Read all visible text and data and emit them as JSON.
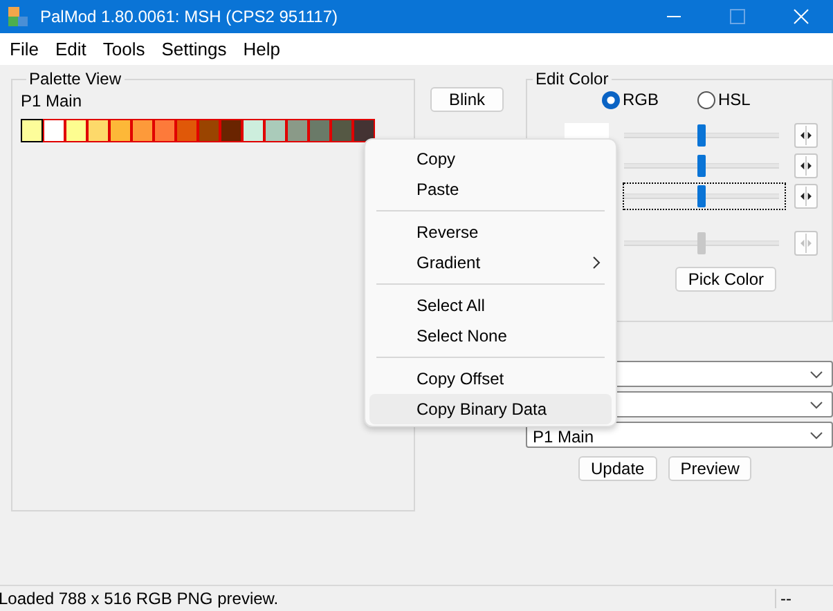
{
  "window": {
    "title": "PalMod 1.80.0061: MSH (CPS2 951117)"
  },
  "menu_bar": [
    "File",
    "Edit",
    "Tools",
    "Settings",
    "Help"
  ],
  "palette_view": {
    "title": "Palette View",
    "palette_name": "P1 Main",
    "swatches": [
      {
        "color": "#fdfd9a",
        "selected": true
      },
      {
        "color": "#ffffff",
        "selected": false
      },
      {
        "color": "#fdfd90",
        "selected": false
      },
      {
        "color": "#fdd96a",
        "selected": false
      },
      {
        "color": "#fdb838",
        "selected": false
      },
      {
        "color": "#fd9a3a",
        "selected": false
      },
      {
        "color": "#fd7a3a",
        "selected": false
      },
      {
        "color": "#e05808",
        "selected": false
      },
      {
        "color": "#9a4400",
        "selected": false
      },
      {
        "color": "#6a2400",
        "selected": false
      },
      {
        "color": "#cdeedd",
        "selected": false
      },
      {
        "color": "#aacbba",
        "selected": false
      },
      {
        "color": "#8a9a88",
        "selected": false
      },
      {
        "color": "#6a7a68",
        "selected": false
      },
      {
        "color": "#555844",
        "selected": false
      },
      {
        "color": "#443333",
        "selected": false
      }
    ]
  },
  "side_buttons": [
    "Blink"
  ],
  "edit_color": {
    "title": "Edit Color",
    "modes": [
      {
        "label": "RGB",
        "selected": true
      },
      {
        "label": "HSL",
        "selected": false
      }
    ],
    "channels": [
      {
        "level": 0.5,
        "focused": false,
        "disabled": false
      },
      {
        "level": 0.5,
        "focused": false,
        "disabled": false
      },
      {
        "level": 0.5,
        "focused": true,
        "disabled": false
      },
      {
        "level": 0.5,
        "focused": false,
        "disabled": true
      }
    ],
    "pick_button": "Pick Color"
  },
  "dropdowns": [
    {
      "kind": "blank"
    },
    {
      "kind": "blank"
    },
    {
      "kind": "value",
      "value": "P1 Main"
    }
  ],
  "buttons": [
    "Update",
    "Preview"
  ],
  "context_menu": {
    "items": [
      {
        "kind": "item",
        "label": "Copy",
        "submenu": false,
        "selected": false
      },
      {
        "kind": "item",
        "label": "Paste",
        "submenu": false,
        "selected": false
      },
      {
        "kind": "separator"
      },
      {
        "kind": "item",
        "label": "Reverse",
        "submenu": false,
        "selected": false
      },
      {
        "kind": "item",
        "label": "Gradient",
        "submenu": true,
        "selected": false
      },
      {
        "kind": "separator"
      },
      {
        "kind": "item",
        "label": "Select All",
        "submenu": false,
        "selected": false
      },
      {
        "kind": "item",
        "label": "Select None",
        "submenu": false,
        "selected": false
      },
      {
        "kind": "separator"
      },
      {
        "kind": "item",
        "label": "Copy Offset",
        "submenu": false,
        "selected": false
      },
      {
        "kind": "item",
        "label": "Copy Binary Data",
        "submenu": false,
        "selected": true
      }
    ]
  },
  "status_bar": {
    "message": "Loaded 788 x 516 RGB PNG preview.",
    "pane_2": "--"
  }
}
